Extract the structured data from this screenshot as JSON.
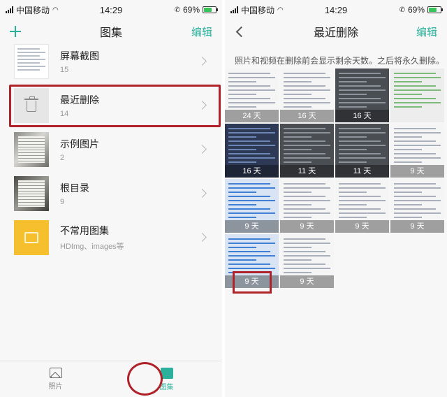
{
  "status_bar": {
    "carrier": "中国移动",
    "time": "14:29",
    "battery": "69%"
  },
  "left_screen": {
    "title": "图集",
    "edit_label": "编辑",
    "albums": [
      {
        "name": "屏幕截图",
        "count": "15"
      },
      {
        "name": "最近删除",
        "count": "14"
      },
      {
        "name": "示例图片",
        "count": "2"
      },
      {
        "name": "根目录",
        "count": "9"
      },
      {
        "name": "不常用图集",
        "count": "HDImg、images等"
      }
    ],
    "tabs": [
      {
        "label": "照片"
      },
      {
        "label": "图集"
      }
    ]
  },
  "right_screen": {
    "title": "最近删除",
    "edit_label": "编辑",
    "notice": "照片和视频在删除前会显示剩余天数。之后将永久删除。",
    "items": [
      {
        "days": "24 天",
        "style": "t-doc"
      },
      {
        "days": "16 天",
        "style": "t-doc"
      },
      {
        "days": "16 天",
        "style": "t-dark"
      },
      {
        "days": "",
        "style": "t-sheet"
      },
      {
        "days": "16 天",
        "style": "t-phone"
      },
      {
        "days": "11 天",
        "style": "t-dark"
      },
      {
        "days": "11 天",
        "style": "t-dark"
      },
      {
        "days": "9 天",
        "style": "t-doc"
      },
      {
        "days": "9 天",
        "style": "t-blue"
      },
      {
        "days": "9 天",
        "style": "t-doc"
      },
      {
        "days": "9 天",
        "style": "t-doc"
      },
      {
        "days": "9 天",
        "style": "t-doc"
      },
      {
        "days": "9 天",
        "style": "t-blue"
      },
      {
        "days": "9 天",
        "style": "t-doc"
      }
    ]
  }
}
